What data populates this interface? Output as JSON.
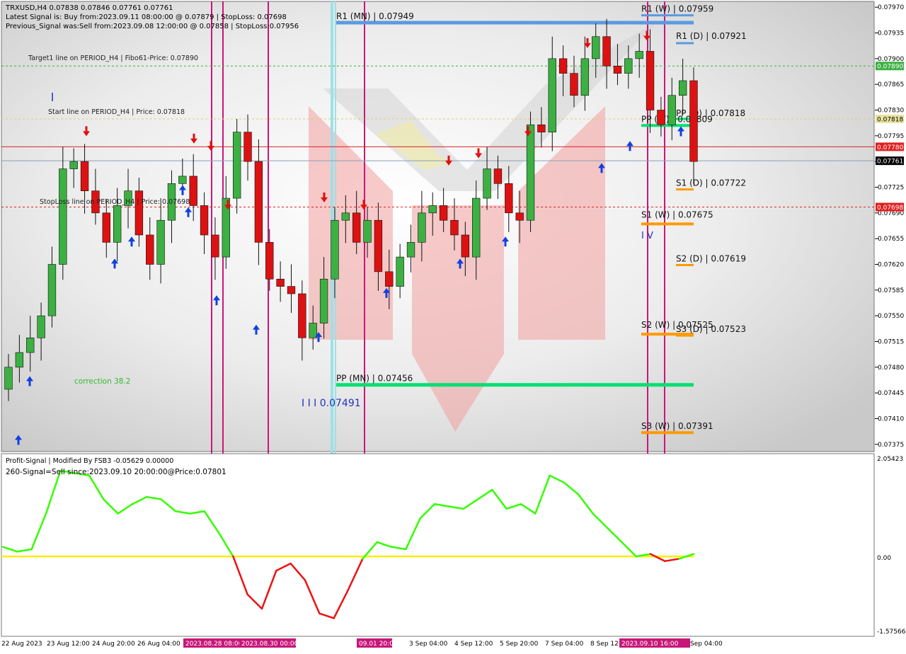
{
  "window": {
    "symbol_line": "TRXUSD,H4  0.07838 0.07846 0.07761 0.07761",
    "latest_signal": "Latest Signal is: Buy from:2023.09.11 08:00:00 @ 0.07879 | StopLoss: 0.07698",
    "previous_signal": "Previous_Signal was:Sell from:2023.09.08 12:00:00 @ 0.07858 | StopLoss:0.07956"
  },
  "chart_labels": {
    "target1": "Target1 line on PERIOD_H4 | Fibo61-Price: 0.07890",
    "start_line": "Start line on PERIOD_H4 | Price: 0.07818",
    "stoploss_line": "StopLoss line on PERIOD_H4 | Price: 0.07698",
    "correction": "correction 38.2",
    "wave_label": "I I I 0.07491",
    "wave_small": "I V"
  },
  "pivots": [
    {
      "label": "R1 (MN) | 0.07949",
      "value": 0.07949,
      "color": "#5a9ae0"
    },
    {
      "label": "R1 (W) | 0.07959",
      "value": 0.07959,
      "color": "#5a9ae0"
    },
    {
      "label": "R1 (D) | 0.07921",
      "value": 0.07921,
      "color": "#5a9ae0"
    },
    {
      "label": "PP (D) | 0.07818",
      "value": 0.07818,
      "color": "#00e070"
    },
    {
      "label": "PP (W) | 0.07809",
      "value": 0.07809,
      "color": "#00e070"
    },
    {
      "label": "S1 (D) | 0.07722",
      "value": 0.07722,
      "color": "#ff9a00"
    },
    {
      "label": "S1 (W) | 0.07675",
      "value": 0.07675,
      "color": "#ff9a00"
    },
    {
      "label": "S2 (D) | 0.07619",
      "value": 0.07619,
      "color": "#ff9a00"
    },
    {
      "label": "S2 (W) | 0.07525",
      "value": 0.07525,
      "color": "#ff9a00"
    },
    {
      "label": "S3 (D) | 0.07523",
      "value": 0.07523,
      "color": "#ff9a00"
    },
    {
      "label": "PP (MN) | 0.07456",
      "value": 0.07456,
      "color": "#00e070"
    },
    {
      "label": "S3 (W) | 0.07391",
      "value": 0.07391,
      "color": "#ff9a00"
    }
  ],
  "price_tags": [
    {
      "value": "0.07890",
      "bg": "#3cb043"
    },
    {
      "value": "0.07818",
      "bg": "#e9e3a0"
    },
    {
      "value": "0.07780",
      "bg": "#e02020"
    },
    {
      "value": "0.07761",
      "bg": "#000000"
    },
    {
      "value": "0.07698",
      "bg": "#e02020"
    }
  ],
  "date_marks": [
    {
      "label": "2023.08.28 08:00",
      "bg": "#c8177a"
    },
    {
      "label": "2023.08.30 00:00",
      "bg": "#c8177a"
    },
    {
      "label": "09.01 20:00",
      "bg": "#c8177a"
    },
    {
      "label": "2023.09.10 16:00",
      "bg": "#c8177a"
    }
  ],
  "indicator": {
    "title": "Profit-Signal | Modified By FSB3 -0.05629 0.00000",
    "signal_text": "260-Signal=Sell since:2023.09.10 20:00:00@Price:0.07801",
    "y_ticks": [
      "2.05423",
      "0.00",
      "-1.57566"
    ],
    "colors": {
      "up": "#33ff00",
      "down": "#ee1111",
      "zero": "#ffee00"
    }
  },
  "colors": {
    "bull": "#3cb043",
    "bear": "#dd1111",
    "up_arrow": "#1040e0",
    "down_arrow": "#e01010",
    "vline": "#c8177a",
    "vline_cyan": "#9fe0e8"
  },
  "chart_data": {
    "type": "candlestick",
    "symbol": "TRXUSD",
    "timeframe": "H4",
    "ylim": [
      0.0737,
      0.07975
    ],
    "y_ticks": [
      "0.07970",
      "0.07935",
      "0.07900",
      "0.07865",
      "0.07830",
      "0.07795",
      "0.07760",
      "0.07725",
      "0.07690",
      "0.07655",
      "0.07620",
      "0.07585",
      "0.07550",
      "0.07515",
      "0.07480",
      "0.07445",
      "0.07410",
      "0.07375"
    ],
    "x_ticks": [
      "22 Aug 2023",
      "23 Aug 12:00",
      "24 Aug 20:00",
      "26 Aug 04:00",
      "3 Sep 04:00",
      "4 Sep 12:00",
      "5 Sep 20:00",
      "7 Sep 04:00",
      "8 Sep 12:",
      "Sep 04:00"
    ],
    "closes": [
      0.0748,
      0.075,
      0.0752,
      0.0755,
      0.0762,
      0.0775,
      0.0776,
      0.0772,
      0.0769,
      0.0765,
      0.077,
      0.0772,
      0.0766,
      0.0762,
      0.0768,
      0.0773,
      0.0774,
      0.077,
      0.0766,
      0.0763,
      0.0771,
      0.078,
      0.0776,
      0.0765,
      0.076,
      0.0759,
      0.0758,
      0.0752,
      0.0754,
      0.076,
      0.0768,
      0.0769,
      0.0765,
      0.0768,
      0.0761,
      0.0759,
      0.0763,
      0.0765,
      0.0769,
      0.077,
      0.0768,
      0.0766,
      0.0763,
      0.0771,
      0.0775,
      0.0773,
      0.0769,
      0.0768,
      0.0781,
      0.078,
      0.079,
      0.0788,
      0.0785,
      0.079,
      0.0793,
      0.0789,
      0.0788,
      0.079,
      0.0791,
      0.0783,
      0.0781,
      0.0785,
      0.0787,
      0.0776
    ],
    "buy_arrows": [
      0.0741,
      0.0749,
      0.0765,
      0.0768,
      0.0775,
      0.0772,
      0.076,
      0.0756,
      0.0755,
      0.0761,
      0.0765,
      0.0768,
      0.0778,
      0.0781,
      0.0783
    ],
    "sell_arrows": [
      0.0778,
      0.0777,
      0.0776,
      0.0768,
      0.0769,
      0.0768,
      0.0774,
      0.0775,
      0.0778,
      0.079,
      0.0791
    ],
    "indicator_series": [
      0.2,
      0.1,
      0.15,
      0.9,
      1.8,
      1.75,
      1.7,
      1.2,
      0.9,
      1.1,
      1.25,
      1.2,
      0.95,
      0.9,
      0.95,
      0.5,
      0.0,
      -0.8,
      -1.1,
      -0.3,
      -0.15,
      -0.5,
      -1.2,
      -1.3,
      -0.7,
      -0.05,
      0.3,
      0.2,
      0.15,
      0.8,
      1.1,
      1.05,
      1.0,
      1.2,
      1.4,
      1.0,
      1.1,
      0.9,
      1.7,
      1.55,
      1.3,
      0.9,
      0.6,
      0.3,
      0.0,
      0.05,
      -0.1,
      -0.05,
      0.05
    ]
  }
}
